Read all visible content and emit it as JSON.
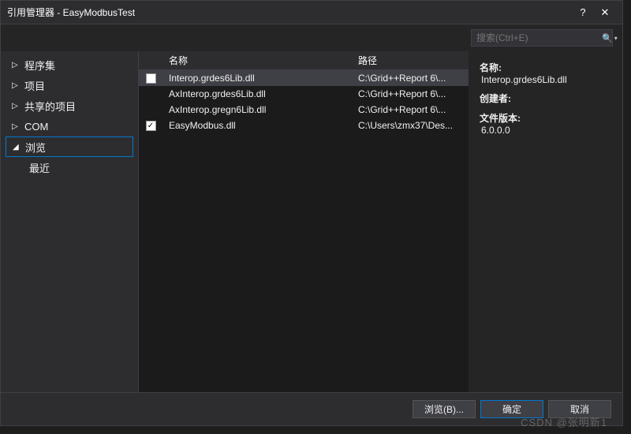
{
  "titlebar": {
    "title": "引用管理器 - EasyModbusTest",
    "help": "?",
    "close": "✕"
  },
  "search": {
    "placeholder": "搜索(Ctrl+E)"
  },
  "sidebar": {
    "items": [
      {
        "label": "程序集",
        "expandable": true
      },
      {
        "label": "项目",
        "expandable": true
      },
      {
        "label": "共享的项目",
        "expandable": true
      },
      {
        "label": "COM",
        "expandable": true
      },
      {
        "label": "浏览",
        "expandable": true,
        "selected": true
      },
      {
        "label": "最近",
        "sub": true
      }
    ]
  },
  "list": {
    "headers": {
      "name": "名称",
      "path": "路径"
    },
    "rows": [
      {
        "checked": false,
        "showCheck": true,
        "name": "Interop.grdes6Lib.dll",
        "path": "C:\\Grid++Report 6\\...",
        "highlighted": true
      },
      {
        "checked": false,
        "showCheck": false,
        "name": "AxInterop.grdes6Lib.dll",
        "path": "C:\\Grid++Report 6\\..."
      },
      {
        "checked": false,
        "showCheck": false,
        "name": "AxInterop.gregn6Lib.dll",
        "path": "C:\\Grid++Report 6\\..."
      },
      {
        "checked": true,
        "showCheck": true,
        "name": "EasyModbus.dll",
        "path": "C:\\Users\\zmx37\\Des..."
      }
    ]
  },
  "details": {
    "name_label": "名称:",
    "name_value": "Interop.grdes6Lib.dll",
    "creator_label": "创建者:",
    "creator_value": "",
    "version_label": "文件版本:",
    "version_value": "6.0.0.0"
  },
  "footer": {
    "browse": "浏览(B)...",
    "ok": "确定",
    "cancel": "取消"
  },
  "watermark": "CSDN @张明新1"
}
